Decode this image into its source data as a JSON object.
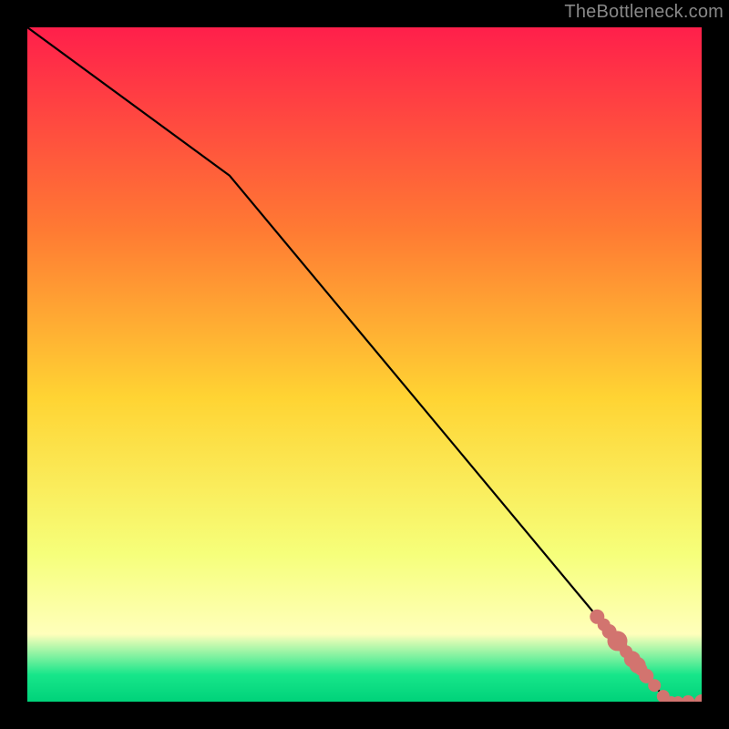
{
  "watermark": "TheBottleneck.com",
  "chart_data": {
    "type": "line",
    "title": "",
    "xlabel": "",
    "ylabel": "",
    "xlim": [
      0,
      100
    ],
    "ylim": [
      0,
      100
    ],
    "grid": false,
    "legend": false,
    "gradient": {
      "top_color": "#ff1f4b",
      "mid_upper_color": "#ff7a33",
      "mid_color": "#ffd433",
      "mid_lower_color": "#f6ff7a",
      "pale_yellow": "#ffffbb",
      "green_color": "#17e68a",
      "bottom_color": "#00d27a"
    },
    "series": [
      {
        "name": "curve",
        "x": [
          0,
          30,
          95,
          100
        ],
        "y": [
          100,
          78,
          0,
          0
        ]
      }
    ],
    "points": {
      "name": "markers",
      "color": "#d2746f",
      "x": [
        84.5,
        85.5,
        86.3,
        87.5,
        88.0,
        88.8,
        89.7,
        90.5,
        91.0,
        91.8,
        93.0,
        94.3,
        95.5,
        96.5,
        98.0,
        100.0
      ],
      "y": [
        12.6,
        11.4,
        10.4,
        9.0,
        8.4,
        7.4,
        6.3,
        5.4,
        4.8,
        3.8,
        2.4,
        0.8,
        0.0,
        0.0,
        0.0,
        0.0
      ],
      "r": [
        8,
        7,
        8,
        11,
        7,
        7,
        9,
        9,
        7,
        8,
        7,
        7,
        6,
        6,
        7,
        8
      ]
    }
  }
}
